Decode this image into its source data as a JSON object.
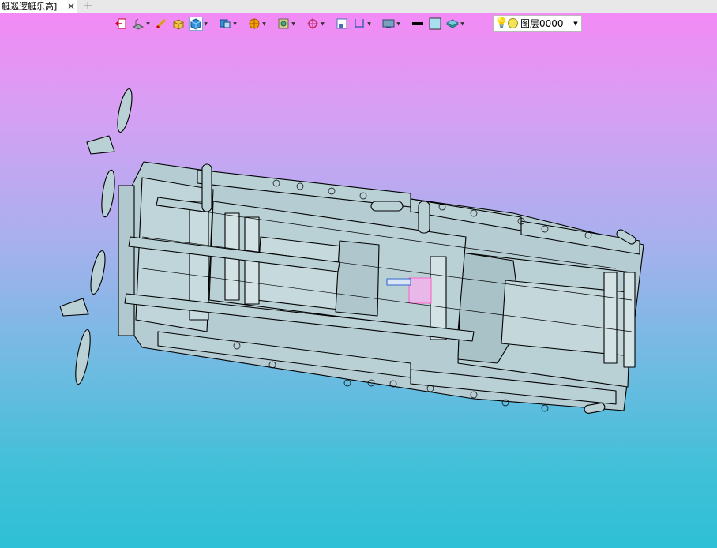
{
  "tab": {
    "title": "艇巡逻艇乐高]",
    "close_glyph": "✕",
    "add_glyph": "+"
  },
  "toolbar": {
    "buttons": [
      {
        "name": "exit-sketch-icon"
      },
      {
        "name": "view-orient-icon",
        "dropdown": true
      },
      {
        "name": "measure-icon"
      },
      {
        "name": "box-render-icon"
      },
      {
        "name": "shaded-render-icon",
        "dropdown": true,
        "active": true
      },
      {
        "name": "render-mode-icon",
        "dropdown": true
      },
      {
        "name": "section-view-icon",
        "dropdown": true
      },
      {
        "name": "show-hide-icon",
        "dropdown": true
      },
      {
        "name": "snap-center-icon",
        "dropdown": true
      },
      {
        "name": "frame-icon"
      },
      {
        "name": "dimension-icon",
        "dropdown": true
      },
      {
        "name": "display-settings-icon",
        "dropdown": true
      },
      {
        "name": "line-color-icon"
      },
      {
        "name": "fill-color-icon"
      },
      {
        "name": "layer-manager-icon",
        "dropdown": true
      }
    ]
  },
  "layer": {
    "current": "图层0000",
    "bulb_glyph": "💡",
    "dropdown_glyph": "▼"
  },
  "colors": {
    "model_fill": "#b9d0d5",
    "model_stroke": "#000000",
    "highlight": "#ff66cc"
  }
}
